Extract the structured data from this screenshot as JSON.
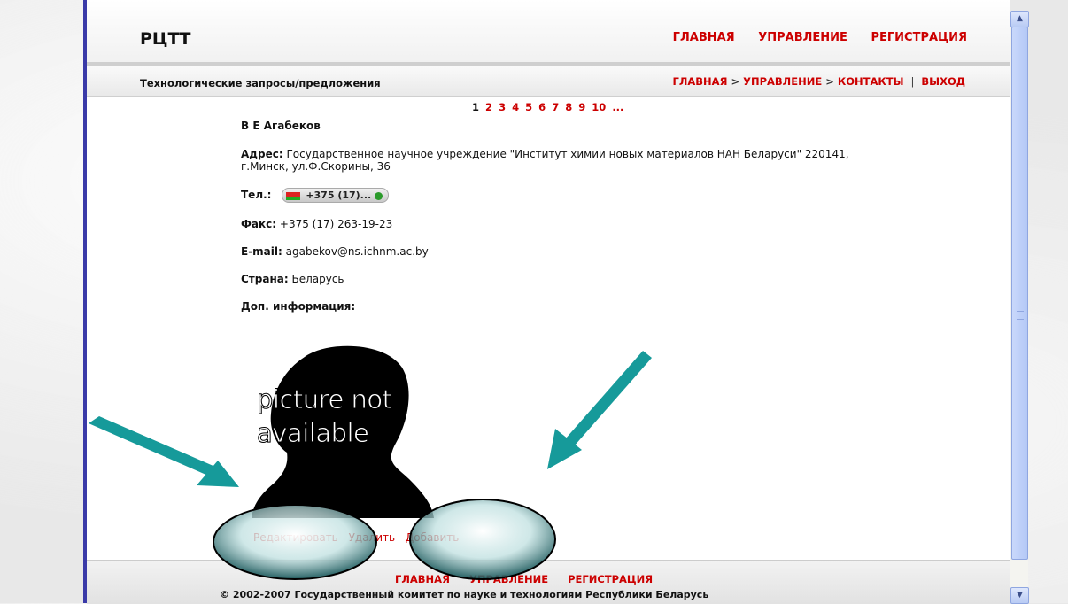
{
  "header": {
    "logo": "РЦТТ",
    "nav": [
      "ГЛАВНАЯ",
      "УПРАВЛЕНИЕ",
      "РЕГИСТРАЦИЯ"
    ]
  },
  "subbar": {
    "title": "Технологические запросы/предложения",
    "breadcrumb": [
      "ГЛАВНАЯ",
      "УПРАВЛЕНИЕ",
      "КОНТАКТЫ"
    ],
    "breadcrumb_sep": ">",
    "bar_sep": "|",
    "logout": "ВЫХОД"
  },
  "pager": {
    "current": "1",
    "pages": [
      "2",
      "3",
      "4",
      "5",
      "6",
      "7",
      "8",
      "9",
      "10",
      "..."
    ]
  },
  "contact": {
    "name": "В Е Агабеков",
    "address_label": "Адрес:",
    "address_value": "Государственное научное учреждение \"Институт химии новых материалов НАН Беларуси\" 220141, г.Минск, ул.Ф.Скорины, 36",
    "phone_label": "Тел.:",
    "phone_value": "+375 (17)...",
    "fax_label": "Факс:",
    "fax_value": "+375 (17) 263-19-23",
    "email_label": "E-mail:",
    "email_value": "agabekov@ns.ichnm.ac.by",
    "country_label": "Страна:",
    "country_value": "Беларусь",
    "extra_label": "Доп. информация:"
  },
  "portrait": {
    "line1": "picture not",
    "line2": "available"
  },
  "actions": {
    "edit": "Редактировать",
    "delete": "Удалить",
    "add": "Добавить"
  },
  "footer": {
    "nav": [
      "ГЛАВНАЯ",
      "УПРАВЛЕНИЕ",
      "РЕГИСТРАЦИЯ"
    ],
    "copyright": "© 2002-2007 Государственный комитет по науке и технологиям Республики Беларусь"
  },
  "colors": {
    "link": "#cc0000",
    "arrow": "#169a9a",
    "frame": "#3a3aa8"
  },
  "icons": [
    "flag-icon",
    "call-icon",
    "scroll-up-icon",
    "scroll-down-icon"
  ]
}
